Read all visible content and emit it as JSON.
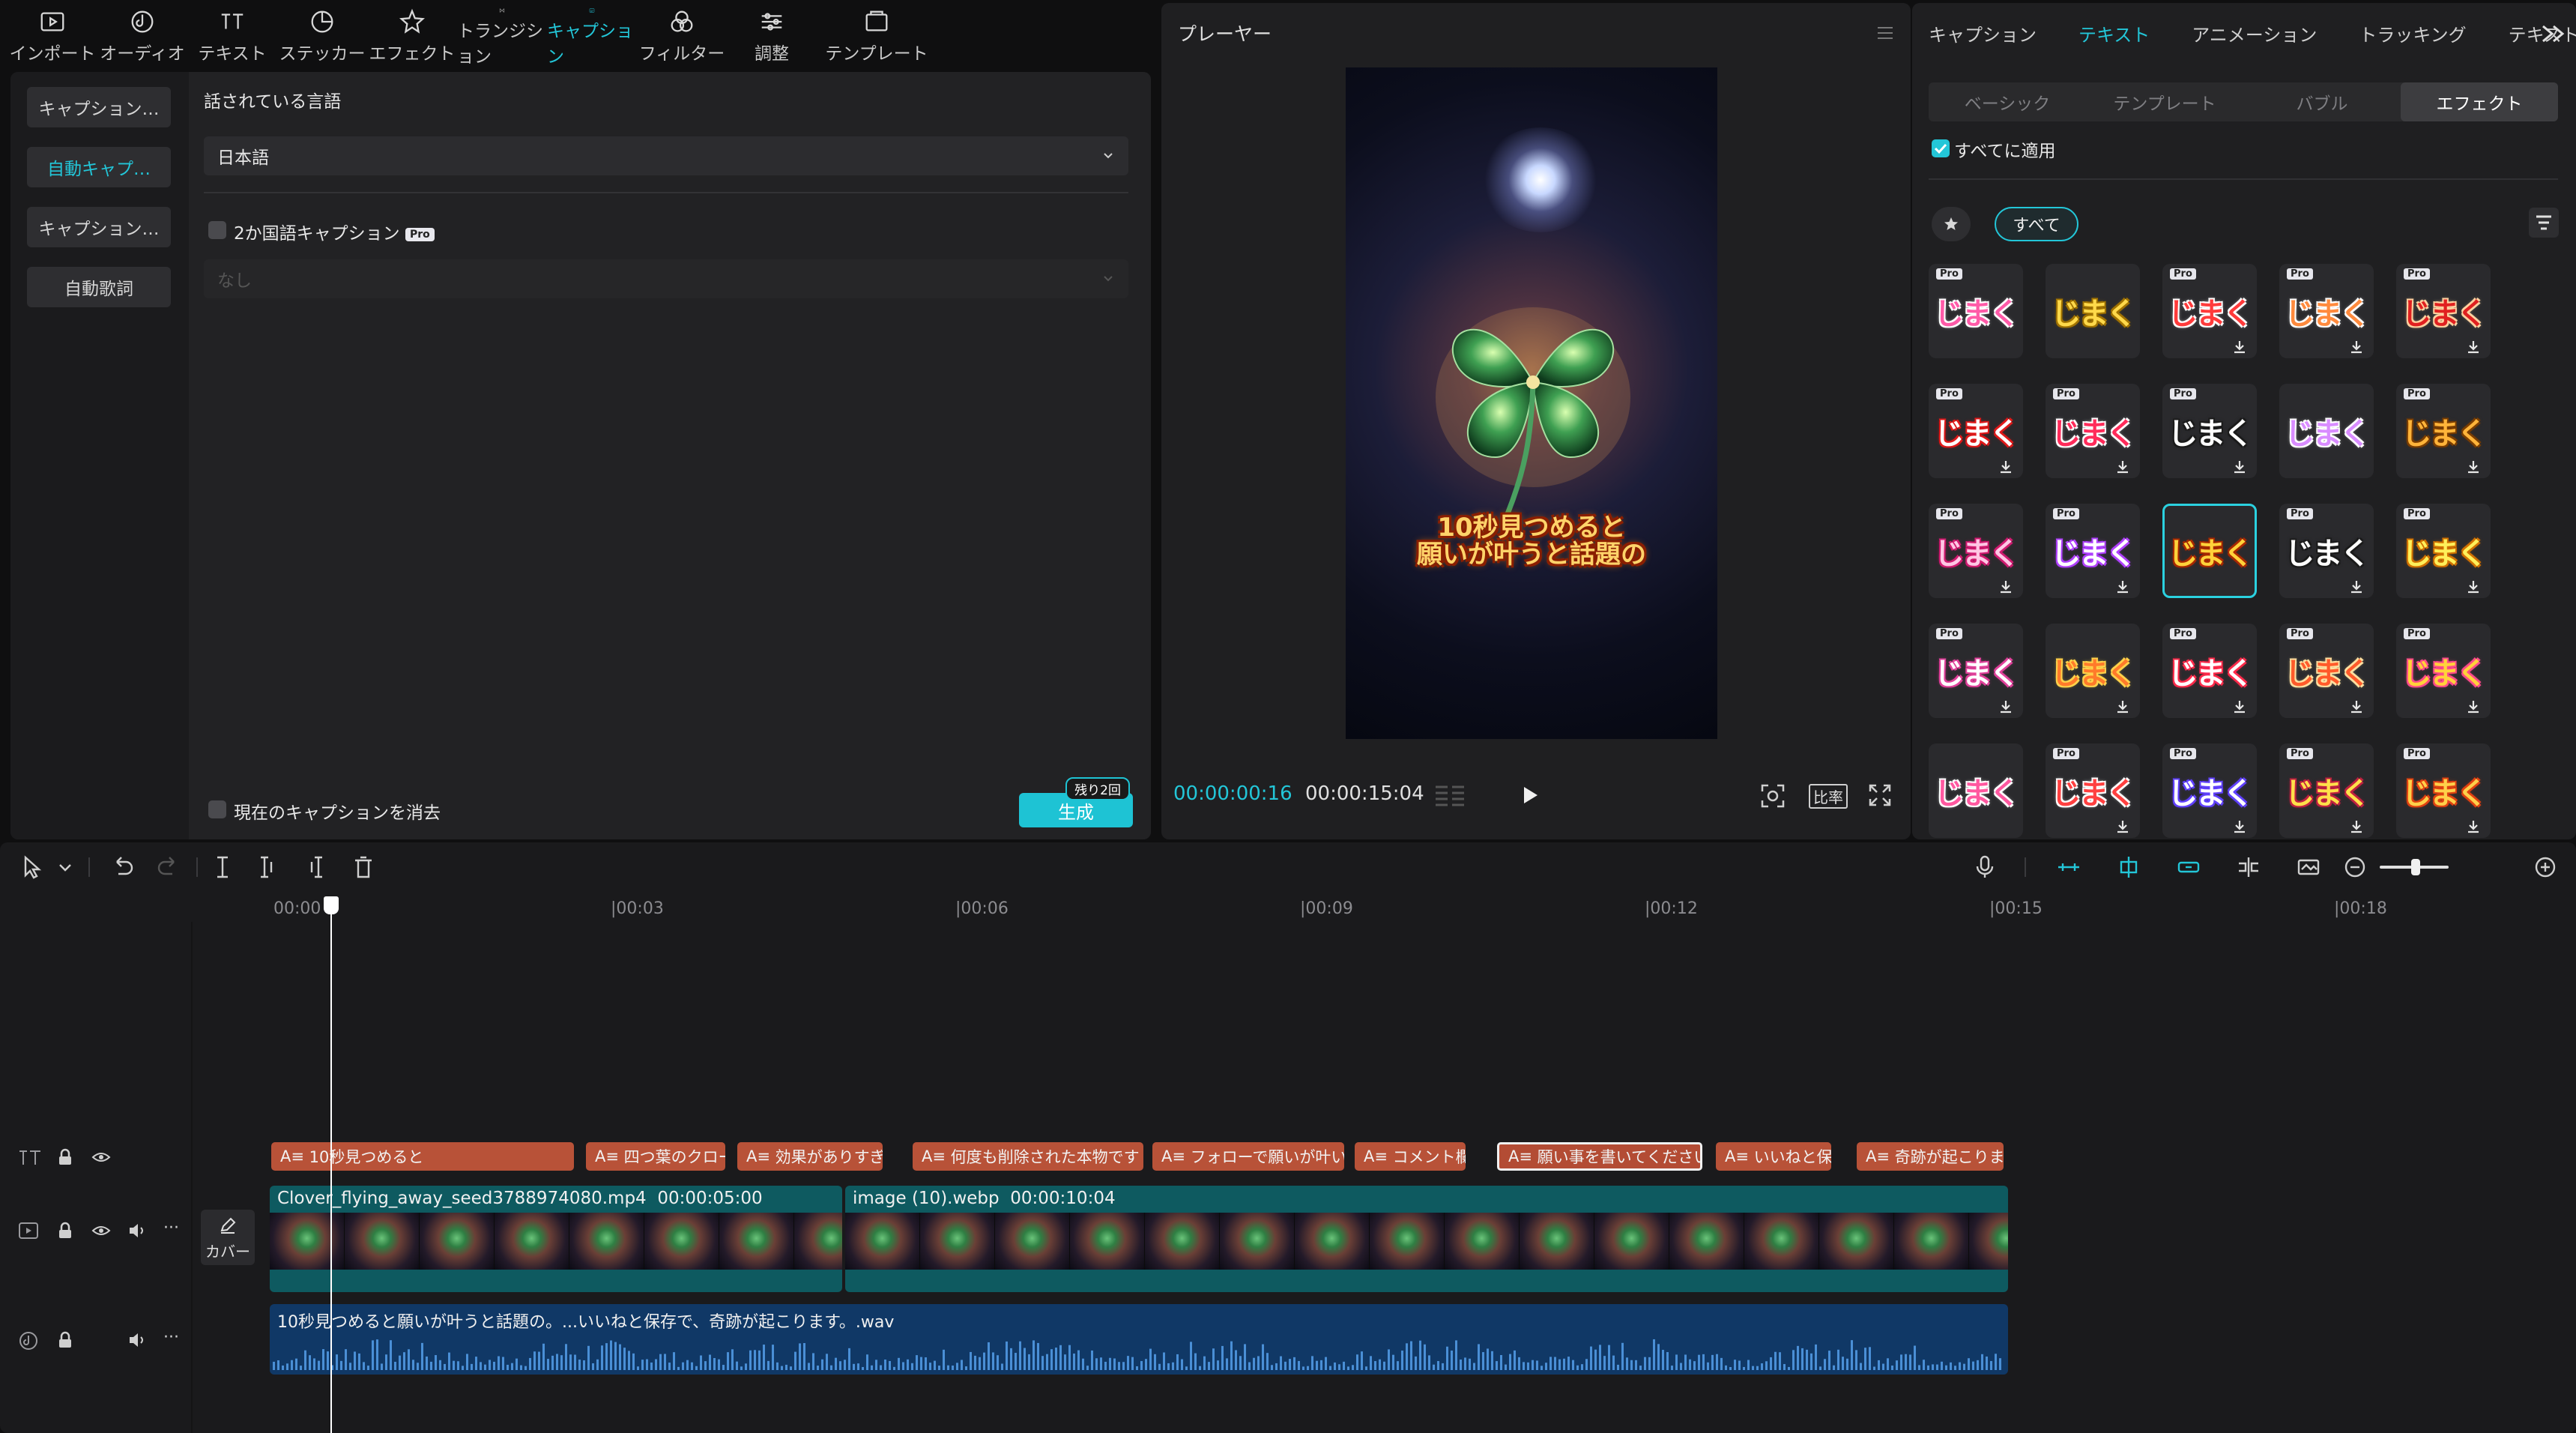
{
  "toolbar": {
    "items": [
      {
        "label": "インポート"
      },
      {
        "label": "オーディオ"
      },
      {
        "label": "テキスト"
      },
      {
        "label": "ステッカー"
      },
      {
        "label": "エフェクト"
      },
      {
        "label": "トランジション"
      },
      {
        "label": "キャプション",
        "active": true
      },
      {
        "label": "フィルター"
      },
      {
        "label": "調整"
      },
      {
        "label": "テンプレート"
      }
    ]
  },
  "caption_panel": {
    "sidebar": [
      "キャプション…",
      "自動キャプ…",
      "キャプション…",
      "自動歌詞"
    ],
    "language_label": "話されている言語",
    "language_value": "日本語",
    "bilingual_label": "2か国語キャプション",
    "pro_badge": "Pro",
    "secondary_placeholder": "なし",
    "clear_label": "現在のキャプションを消去",
    "generate_label": "生成",
    "remaining_label": "残り2回"
  },
  "player": {
    "title": "プレーヤー",
    "subtitle_line1": "10秒見つめると",
    "subtitle_line2": "願いが叶うと話題の",
    "current_time": "00:00:00:16",
    "total_time": "00:00:15:04",
    "ratio_label": "比率"
  },
  "text_panel": {
    "tabs": [
      "キャプション",
      "テキスト",
      "アニメーション",
      "トラッキング",
      "テキスト読み…"
    ],
    "active_tab": "テキスト",
    "sub_tabs": [
      "ベーシック",
      "テンプレート",
      "バブル",
      "エフェクト"
    ],
    "active_sub_tab": "エフェクト",
    "apply_all_label": "すべてに適用",
    "filter_all_label": "すべて",
    "effect_text": "じまく",
    "effects": [
      {
        "pro": true,
        "color": "#ff5aa8",
        "outline": "#ffffff",
        "download": false
      },
      {
        "pro": false,
        "color": "#ffd94a",
        "outline": "#a07200",
        "download": false
      },
      {
        "pro": true,
        "color": "#ff3b3b",
        "outline": "#ffffff",
        "download": true
      },
      {
        "pro": true,
        "color": "#ff8a3d",
        "outline": "#ffffff",
        "download": true
      },
      {
        "pro": true,
        "color": "#e02020",
        "outline": "#ffd2a0",
        "download": true
      },
      {
        "pro": true,
        "color": "#ffffff",
        "outline": "#e01818",
        "download": true
      },
      {
        "pro": true,
        "color": "#ff2b5a",
        "outline": "#ffffff",
        "download": true
      },
      {
        "pro": true,
        "color": "#ffffff",
        "outline": "#1a1a1a",
        "download": true
      },
      {
        "pro": false,
        "color": "#d98cff",
        "outline": "#ffffff",
        "download": false
      },
      {
        "pro": true,
        "color": "#ffb43a",
        "outline": "#7a3d00",
        "download": true
      },
      {
        "pro": true,
        "color": "#ffc6e4",
        "outline": "#d01a70",
        "download": true
      },
      {
        "pro": true,
        "color": "#ffffff",
        "outline": "#b040ff",
        "download": true
      },
      {
        "pro": false,
        "color": "#ffd23a",
        "outline": "#a82800",
        "download": false,
        "selected": true
      },
      {
        "pro": true,
        "color": "#ffffff",
        "outline": "#1a1a1a",
        "download": true
      },
      {
        "pro": true,
        "color": "#fff05a",
        "outline": "#d07000",
        "download": true
      },
      {
        "pro": true,
        "color": "#ffffff",
        "outline": "#e0409a",
        "download": true
      },
      {
        "pro": false,
        "color": "#ff7a2a",
        "outline": "#ffd24a",
        "download": true
      },
      {
        "pro": true,
        "color": "#ffffff",
        "outline": "#ff2a4a",
        "download": true
      },
      {
        "pro": true,
        "color": "#ff5a2a",
        "outline": "#ffe0a0",
        "download": true
      },
      {
        "pro": true,
        "color": "#ffd23a",
        "outline": "#ff4a8a",
        "download": true
      },
      {
        "pro": false,
        "color": "#ff58a0",
        "outline": "#ffffff",
        "download": false
      },
      {
        "pro": true,
        "color": "#ff4040",
        "outline": "#ffffff",
        "download": true
      },
      {
        "pro": true,
        "color": "#ffffff",
        "outline": "#6040ff",
        "download": true
      },
      {
        "pro": true,
        "color": "#ffe04a",
        "outline": "#c02040",
        "download": true
      },
      {
        "pro": true,
        "color": "#ffd04a",
        "outline": "#e04010",
        "download": true
      }
    ]
  },
  "timeline": {
    "ruler": [
      "00:00",
      "|00:03",
      "|00:06",
      "|00:09",
      "|00:12",
      "|00:15",
      "|00:18"
    ],
    "cover_label": "カバー",
    "captions": [
      {
        "text": "10秒見つめると"
      },
      {
        "text": "四つ葉のクロー"
      },
      {
        "text": "効果がありすぎ"
      },
      {
        "text": "何度も削除された本物です"
      },
      {
        "text": "フォローで願いが叶いま"
      },
      {
        "text": "コメント欄に"
      },
      {
        "text": "願い事を書いてください",
        "selected": true
      },
      {
        "text": "いいねと保存"
      },
      {
        "text": "奇跡が起こりま"
      }
    ],
    "video_clips": [
      {
        "name": "Clover_flying_away_seed3788974080.mp4",
        "duration": "00:00:05:00"
      },
      {
        "name": "image (10).webp",
        "duration": "00:00:10:04"
      }
    ],
    "audio_clip": {
      "name": "10秒見つめると願いが叶うと話題の。...いいねと保存で、奇跡が起こります。.wav"
    }
  }
}
